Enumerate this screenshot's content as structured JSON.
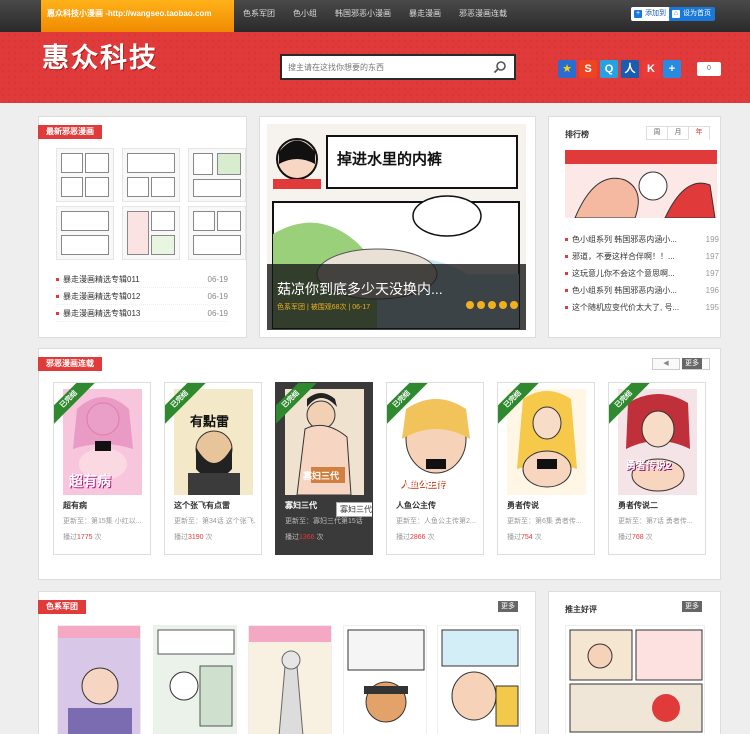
{
  "topbar": {
    "shop_link": "惠众科技小漫画 -http://wangseo.taobao.com",
    "nav": [
      "色系军团",
      "色小组",
      "韩国邪恶小漫画",
      "暴走漫画",
      "邪恶漫画连载"
    ],
    "add_fav": "添加到",
    "set_home": "设为首页"
  },
  "header": {
    "logo": "惠众科技",
    "search_placeholder": "搜主请在这找你想要的东西",
    "share_count": "0"
  },
  "newest": {
    "title": "最新邪恶漫画",
    "items": [
      {
        "label": "暴走漫画精选专辑011",
        "date": "06-19"
      },
      {
        "label": "暴走漫画精选专辑012",
        "date": "06-19"
      },
      {
        "label": "暴走漫画精选专辑013",
        "date": "06-19"
      }
    ]
  },
  "slider": {
    "banner_text": "掉进水里的内裤",
    "caption_title": "菇凉你到底多少天没换内...",
    "caption_meta": "色系军团 | 被围观68次 | 06-17"
  },
  "rank": {
    "title": "排行榜",
    "tabs": [
      "周",
      "月",
      "年"
    ],
    "items": [
      {
        "label": "色小组系列 韩国邪恶内涵小...",
        "count": "199"
      },
      {
        "label": "邪道，不要这样合伴啊！！...",
        "count": "197"
      },
      {
        "label": "这玩意儿你不会这个意思啊...",
        "count": "197"
      },
      {
        "label": "色小组系列 韩国邪恶内涵小...",
        "count": "196"
      },
      {
        "label": "这个随机应变代价太大了, 号...",
        "count": "195"
      }
    ]
  },
  "serial": {
    "title": "邪恶漫画连载",
    "prev": "◀",
    "next": "▶",
    "more": "更多",
    "ribbon": "已完结",
    "tooltip": "寡妇三代",
    "cards": [
      {
        "name": "超有病",
        "update": "更新至：第15集 小红以...",
        "views_prefix": "播过",
        "views": "1775",
        "views_suffix": "次"
      },
      {
        "name": "这个张飞有点雷",
        "update": "更新至：第34话 这个张飞...",
        "views_prefix": "播过",
        "views": "3190",
        "views_suffix": "次"
      },
      {
        "name": "寡妇三代",
        "update": "更新至：寡妇三代第15话",
        "views_prefix": "播过",
        "views": "1366",
        "views_suffix": "次"
      },
      {
        "name": "人鱼公主传",
        "update": "更新至：人鱼公主传第2...",
        "views_prefix": "播过",
        "views": "2866",
        "views_suffix": "次"
      },
      {
        "name": "勇者传说",
        "update": "更新至：第6集 勇者传...",
        "views_prefix": "播过",
        "views": "754",
        "views_suffix": "次"
      },
      {
        "name": "勇者传说二",
        "update": "更新至：第7话 勇者传...",
        "views_prefix": "播过",
        "views": "768",
        "views_suffix": "次"
      }
    ],
    "cover_texts": [
      "超有病",
      "有點雷",
      "寡妇三代",
      "人鱼公主传",
      "",
      "勇者传说2"
    ]
  },
  "color_group": {
    "title": "色系军团",
    "more": "更多"
  },
  "recommend": {
    "title": "推主好评",
    "more": "更多"
  },
  "colors": {
    "brand_red": "#e03a3a",
    "topbar": "#333333",
    "shop_orange": "#f6a012",
    "ribbon_green": "#2f8a2f"
  }
}
